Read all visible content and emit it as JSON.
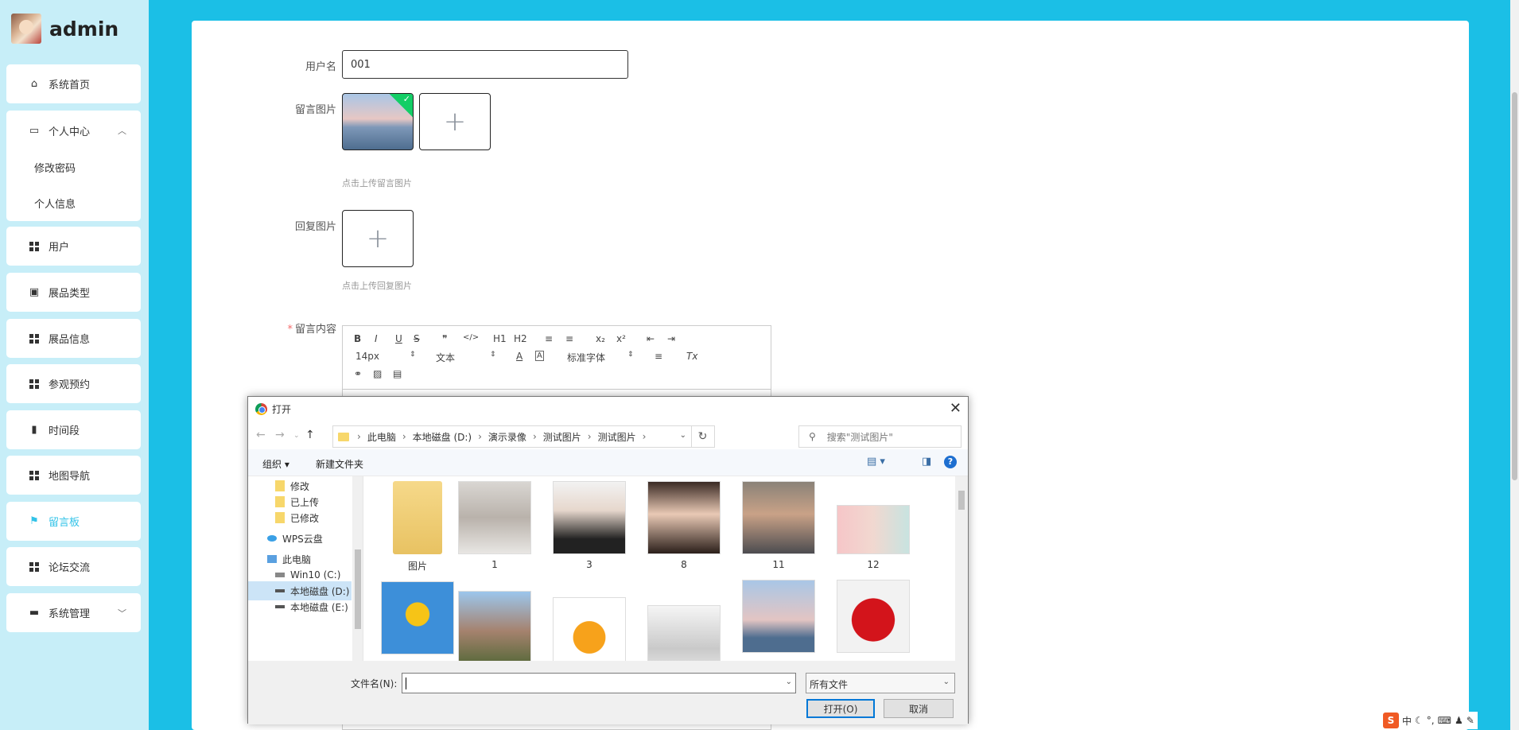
{
  "sidebar": {
    "brand": "admin",
    "items": [
      {
        "label": "系统首页"
      },
      {
        "label": "个人中心"
      },
      {
        "label": "用户"
      },
      {
        "label": "展品类型"
      },
      {
        "label": "展品信息"
      },
      {
        "label": "参观预约"
      },
      {
        "label": "时间段"
      },
      {
        "label": "地图导航"
      },
      {
        "label": "留言板"
      },
      {
        "label": "论坛交流"
      },
      {
        "label": "系统管理"
      }
    ],
    "submenu": [
      "修改密码",
      "个人信息"
    ],
    "active_index": 8,
    "accent": "#33c3e8"
  },
  "form": {
    "username_label": "用户名",
    "username_value": "001",
    "msg_image_label": "留言图片",
    "msg_image_hint": "点击上传留言图片",
    "reply_image_label": "回复图片",
    "reply_image_hint": "点击上传回复图片",
    "content_label": "留言内容",
    "required_mark": "*",
    "plus": "+"
  },
  "editor": {
    "buttons_row1": [
      "B",
      "I",
      "U",
      "S",
      "❞",
      "</>",
      "H1",
      "H2",
      "≡",
      "≡",
      "x₂",
      "x²",
      "⇤",
      "⇥"
    ],
    "font_size": "14px",
    "text_type": "文本",
    "font_family": "标准字体",
    "clear_format": "Tx"
  },
  "dialog": {
    "title": "打开",
    "breadcrumb": [
      "此电脑",
      "本地磁盘 (D:)",
      "演示录像",
      "测试图片",
      "测试图片"
    ],
    "search_placeholder": "搜索\"测试图片\"",
    "organize": "组织 ▾",
    "new_folder": "新建文件夹",
    "tree": [
      {
        "label": "修改"
      },
      {
        "label": "已上传"
      },
      {
        "label": "已修改"
      },
      {
        "label": "WPS云盘"
      },
      {
        "label": "此电脑"
      },
      {
        "label": "Win10 (C:)"
      },
      {
        "label": "本地磁盘 (D:)"
      },
      {
        "label": "本地磁盘 (E:)"
      }
    ],
    "files_row1": [
      "图片",
      "1",
      "3",
      "8",
      "11",
      "12"
    ],
    "filename_label": "文件名(N):",
    "filename_value": "",
    "filetype": "所有文件",
    "open_button": "打开(O)",
    "cancel_button": "取消"
  },
  "ime": {
    "logo": "S",
    "mode": "中"
  }
}
